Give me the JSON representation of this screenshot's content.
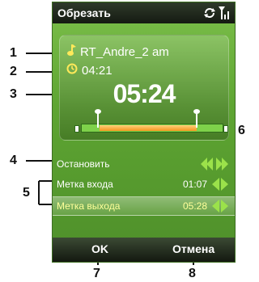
{
  "window": {
    "title": "Обрезать"
  },
  "status": {
    "icons": [
      "sync-icon",
      "signal-icon"
    ]
  },
  "player": {
    "track_name": "RT_Andre_2 am",
    "duration": "04:21",
    "current_time": "05:24"
  },
  "controls": {
    "stop_label": "Остановить",
    "in_mark_label": "Метка входа",
    "in_mark_value": "01:07",
    "out_mark_label": "Метка выхода",
    "out_mark_value": "05:28"
  },
  "softkeys": {
    "left": "OK",
    "right": "Отмена"
  },
  "callouts": [
    "1",
    "2",
    "3",
    "4",
    "5",
    "6",
    "7",
    "8"
  ],
  "colors": {
    "accent_green": "#5ea532",
    "trim_orange": "#f3961f",
    "arrow_green": "#9be24a"
  }
}
